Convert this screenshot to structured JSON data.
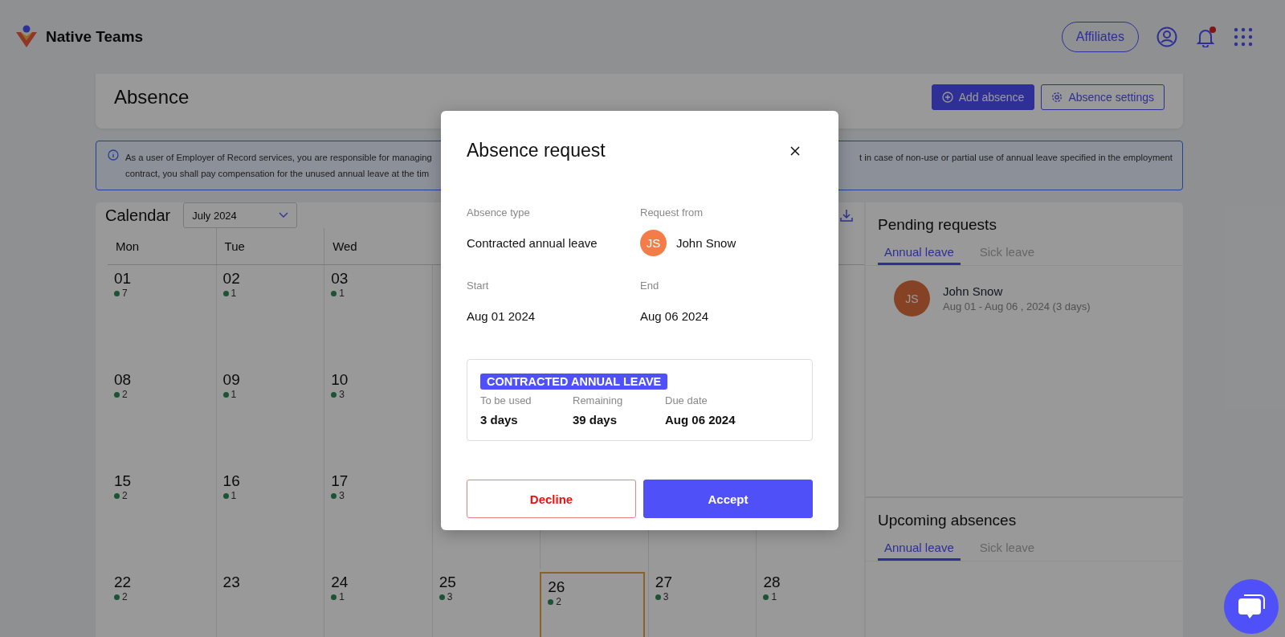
{
  "app_bar": {
    "brand": "Native Teams",
    "affiliates_button": "Affiliates",
    "notification_unread": true
  },
  "page_header": {
    "title": "Absence",
    "buttons": [
      {
        "label": "Add absence",
        "kind": "primary"
      },
      {
        "label": "Absence settings",
        "kind": "secondary"
      }
    ]
  },
  "notice": {
    "left_lines": [
      "As a user of Employer of Record services, you are responsible for managing",
      "contract, you shall pay compensation for the unused annual leave at the tim"
    ],
    "right_lines": [
      "t in case of non-use or partial use of annual leave specified in the employment"
    ]
  },
  "calendar": {
    "title": "Calendar",
    "month_select": "July 2024",
    "weekdays": [
      "Mon",
      "Tue",
      "Wed"
    ],
    "weeks": [
      [
        {
          "day": "01",
          "count": "7",
          "today": false
        },
        {
          "day": "02",
          "count": "1",
          "today": false
        },
        {
          "day": "03",
          "count": "1",
          "today": false
        }
      ],
      [
        {
          "day": "08",
          "count": "2",
          "today": false
        },
        {
          "day": "09",
          "count": "1",
          "today": false
        },
        {
          "day": "10",
          "count": "3",
          "today": false
        }
      ],
      [
        {
          "day": "15",
          "count": "2",
          "today": false
        },
        {
          "day": "16",
          "count": "1",
          "today": false
        },
        {
          "day": "17",
          "count": "3",
          "today": false
        }
      ],
      [
        {
          "day": "22",
          "count": "2",
          "today": false
        },
        {
          "day": "23",
          "today": false
        },
        {
          "day": "24",
          "count": "1",
          "today": false
        },
        {
          "day": "25",
          "count": "3",
          "today": false
        },
        {
          "day": "26",
          "count": "2",
          "today": true
        },
        {
          "day": "27",
          "count": "3",
          "today": false
        },
        {
          "day": "28",
          "count": "1",
          "today": false
        }
      ]
    ]
  },
  "pending_requests": {
    "title": "Pending requests",
    "tabs": [
      {
        "label": "Annual leave",
        "selected": true
      },
      {
        "label": "Sick leave",
        "selected": false
      }
    ],
    "items": [
      {
        "initials": "JS",
        "name": "John Snow",
        "dates": "Aug 01 - Aug 06 , 2024 (3 days)"
      }
    ]
  },
  "upcoming_absences": {
    "title": "Upcoming absences",
    "tabs": [
      {
        "label": "Annual leave",
        "selected": true
      },
      {
        "label": "Sick leave",
        "selected": false
      }
    ]
  },
  "modal": {
    "title": "Absence request",
    "fields": [
      {
        "label": "Absence type",
        "value": "Contracted annual leave"
      },
      {
        "label": "Request from",
        "value": "John Snow",
        "initials": "JS"
      },
      {
        "label": "Start",
        "value": "Aug 01 2024"
      },
      {
        "label": "End",
        "value": "Aug 06 2024"
      }
    ],
    "summary": {
      "tag": "CONTRACTED ANNUAL LEAVE",
      "stats": [
        {
          "label": "To be used",
          "value": "3 days"
        },
        {
          "label": "Remaining",
          "value": "39 days"
        },
        {
          "label": "Due date",
          "value": "Aug 06 2024"
        }
      ]
    },
    "buttons": [
      {
        "label": "Decline",
        "kind": "decline"
      },
      {
        "label": "Accept",
        "kind": "accept"
      }
    ]
  }
}
